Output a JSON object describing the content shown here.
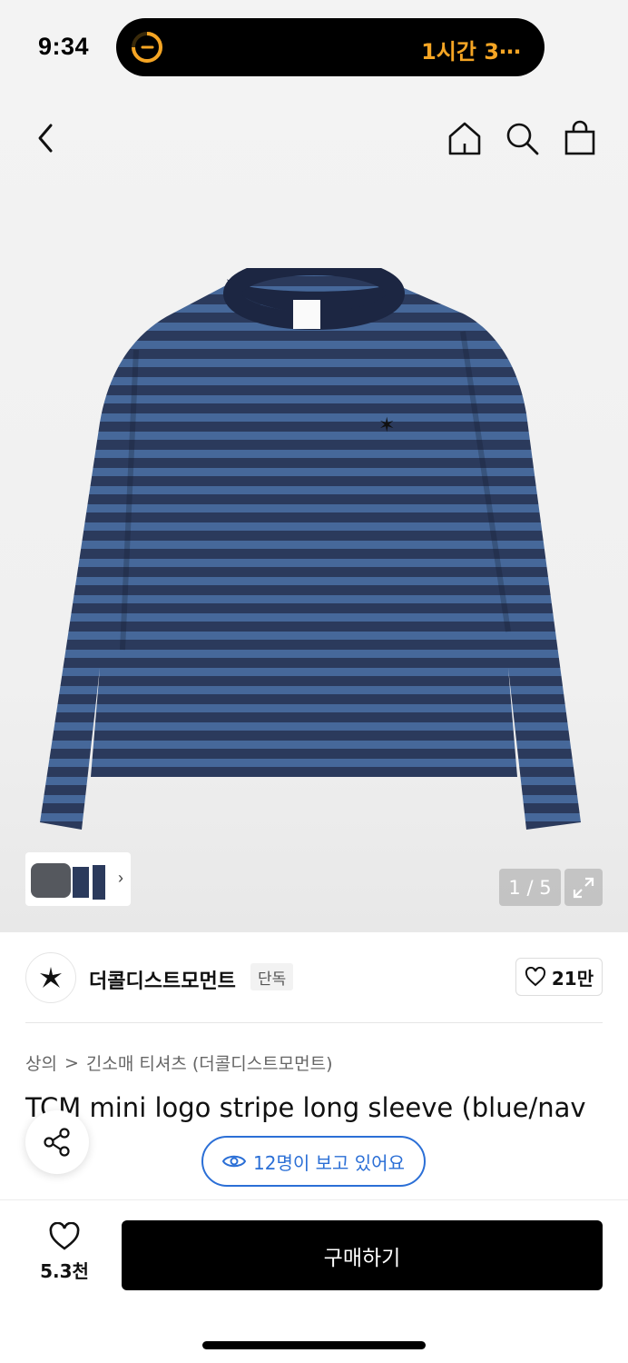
{
  "status_bar": {
    "time": "9:34",
    "island_text": "1시간 3⋯",
    "island_color": "#f5a524"
  },
  "nav": {
    "back_icon": "chevron-left-icon",
    "home_icon": "home-icon",
    "search_icon": "search-icon",
    "bag_icon": "shopping-bag-icon"
  },
  "gallery": {
    "page_counter": "1 / 5",
    "expand_icon": "expand-icon"
  },
  "brand": {
    "name": "더콜디스트모먼트",
    "badge": "단독",
    "like_count": "21만"
  },
  "breadcrumb": {
    "category": "상의",
    "separator": ">",
    "subcategory": "긴소매 티셔츠 (더콜디스트모먼트)"
  },
  "product": {
    "title": "TCM mini logo stripe long sleeve (blue/nav"
  },
  "viewers": {
    "text": "12명이 보고 있어요",
    "accent": "#2b6fd6"
  },
  "bottom_bar": {
    "wish_count": "5.3천",
    "buy_label": "구매하기"
  }
}
